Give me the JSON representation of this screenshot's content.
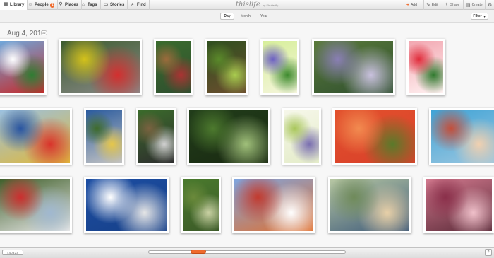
{
  "nav": {
    "library": "Library",
    "people": "People",
    "people_count": "1",
    "places": "Places",
    "tags": "Tags",
    "stories": "Stories",
    "find": "Find"
  },
  "brand": {
    "name": "thislife",
    "by": "by Shutterfly"
  },
  "actions": {
    "add": "Add",
    "edit": "Edit",
    "share": "Share",
    "create": "Create"
  },
  "view_tabs": [
    "Day",
    "Month",
    "Year"
  ],
  "active_view": "Day",
  "filter_label": "Filter",
  "group": {
    "date": "Aug 4, 2011",
    "count": "22"
  },
  "footer": {
    "pager": "440323",
    "help": "?"
  },
  "colors": {
    "accent": "#ef6a2c",
    "toolbar": "#e4e4e4"
  },
  "photos": [
    {
      "name": "legoland-sign",
      "colors": [
        "#6fa8dc",
        "#ffffff",
        "#2e7d32",
        "#c62828"
      ]
    },
    {
      "name": "kids-toy-cars",
      "colors": [
        "#3d5c2e",
        "#d4c21a",
        "#d32f2f",
        "#8a8a8a"
      ]
    },
    {
      "name": "lego-garden-figure",
      "colors": [
        "#3a6b2d",
        "#9c6b3c",
        "#a33",
        "#2f4f2f"
      ]
    },
    {
      "name": "garden-path",
      "colors": [
        "#2f4f1f",
        "#5a8a2a",
        "#a9cc4f",
        "#6b4e2e"
      ]
    },
    {
      "name": "purple-agapanthus",
      "colors": [
        "#d7ef9a",
        "#6b5fc2",
        "#3d8a2e",
        "#f5f5dc"
      ]
    },
    {
      "name": "agapanthus-closeup",
      "colors": [
        "#5a7a3a",
        "#8a7fb5",
        "#c9c1de",
        "#2f4f2f"
      ]
    },
    {
      "name": "red-hibiscus",
      "colors": [
        "#f2a6b0",
        "#e02b3a",
        "#2f7a2e",
        "#fff2f2"
      ]
    },
    {
      "name": "lego-figures-fence",
      "colors": [
        "#9bc1e0",
        "#2854a1",
        "#d9342b",
        "#e0b83a"
      ]
    },
    {
      "name": "boy-statue",
      "colors": [
        "#2b5b9e",
        "#3e6b2a",
        "#e6c74a",
        "#c3c3c3"
      ]
    },
    {
      "name": "chewbacca-statue",
      "colors": [
        "#3b6b2b",
        "#7a6240",
        "#d1d1d1",
        "#2e2e2e"
      ]
    },
    {
      "name": "forest-scene",
      "colors": [
        "#213d1a",
        "#4d7a2e",
        "#a0c07a",
        "#1a2a12"
      ]
    },
    {
      "name": "agapanthus-single",
      "colors": [
        "#f6f7ea",
        "#a8c65a",
        "#7a6fb0",
        "#e4ecc9"
      ]
    },
    {
      "name": "orange-flower",
      "colors": [
        "#e2512d",
        "#f28b50",
        "#5a7a2a",
        "#d9402a"
      ]
    },
    {
      "name": "pool-kids",
      "colors": [
        "#3fa3d6",
        "#c44e3a",
        "#f0d0b0",
        "#9cc7e0"
      ]
    },
    {
      "name": "lego-cars-ride",
      "colors": [
        "#3f5f2a",
        "#cc2e2e",
        "#a0b8d0",
        "#e8e8e8"
      ]
    },
    {
      "name": "men-restroom-sign",
      "colors": [
        "#1c4ea3",
        "#ffffff",
        "#e6e6e6",
        "#174088"
      ]
    },
    {
      "name": "garden-lego-ducks",
      "colors": [
        "#4a7a2d",
        "#6b8a3b",
        "#c9d1a3",
        "#3c5a28"
      ]
    },
    {
      "name": "lego-dragon",
      "colors": [
        "#7fa6e0",
        "#c23a2e",
        "#ffffff",
        "#e06f2e"
      ]
    },
    {
      "name": "boy-hat-portrait",
      "colors": [
        "#b7c7a3",
        "#6f8a5a",
        "#e8d0a8",
        "#3e5a7a"
      ]
    },
    {
      "name": "pink-hibiscus",
      "colors": [
        "#d37a8f",
        "#8a2f4a",
        "#f0c0ca",
        "#5a2a38"
      ]
    }
  ]
}
